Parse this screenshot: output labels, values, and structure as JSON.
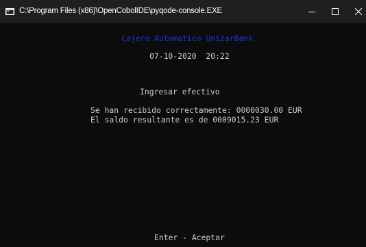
{
  "window": {
    "title": "C:\\Program Files (x86)\\OpenCobolIDE\\pyqode-console.EXE",
    "icon": "console-icon",
    "controls": {
      "minimize_icon": "minimize-icon",
      "maximize_icon": "maximize-icon",
      "close_icon": "close-icon"
    }
  },
  "console": {
    "bank_title": "Cajero Automatico UnizarBank",
    "datetime": "07-10-2020  20:22",
    "operation": "Ingresar efectivo",
    "received_msg": "Se han recibido correctamente: 0000030.00 EUR",
    "balance_msg": "El saldo resultante es de 0009015.23 EUR",
    "footer": "Enter - Aceptar"
  },
  "colors": {
    "background": "#0c0c0c",
    "titlebar": "#1f1f1f",
    "text": "#cccccc",
    "title_accent": "#1a35e0"
  }
}
